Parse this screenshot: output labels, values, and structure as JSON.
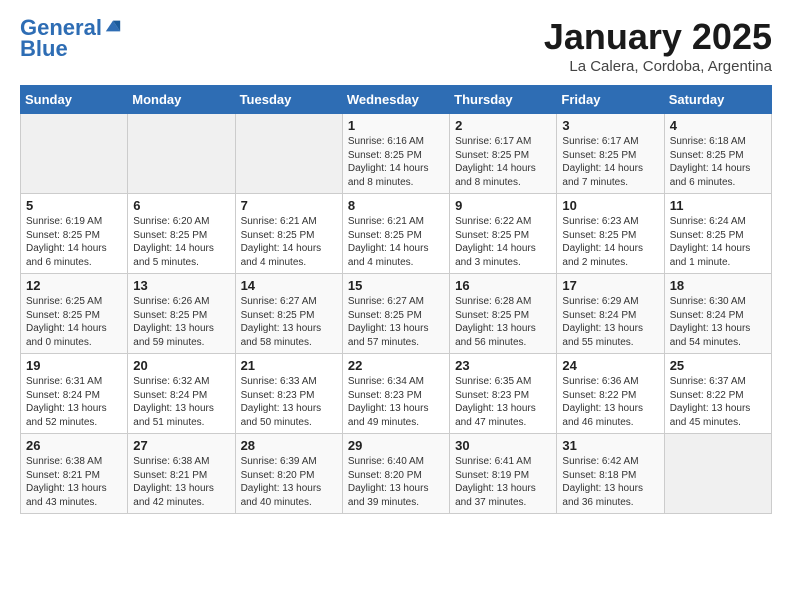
{
  "header": {
    "logo_line1": "General",
    "logo_line2": "Blue",
    "month": "January 2025",
    "location": "La Calera, Cordoba, Argentina"
  },
  "days_of_week": [
    "Sunday",
    "Monday",
    "Tuesday",
    "Wednesday",
    "Thursday",
    "Friday",
    "Saturday"
  ],
  "weeks": [
    [
      {
        "day": "",
        "content": ""
      },
      {
        "day": "",
        "content": ""
      },
      {
        "day": "",
        "content": ""
      },
      {
        "day": "1",
        "content": "Sunrise: 6:16 AM\nSunset: 8:25 PM\nDaylight: 14 hours\nand 8 minutes."
      },
      {
        "day": "2",
        "content": "Sunrise: 6:17 AM\nSunset: 8:25 PM\nDaylight: 14 hours\nand 8 minutes."
      },
      {
        "day": "3",
        "content": "Sunrise: 6:17 AM\nSunset: 8:25 PM\nDaylight: 14 hours\nand 7 minutes."
      },
      {
        "day": "4",
        "content": "Sunrise: 6:18 AM\nSunset: 8:25 PM\nDaylight: 14 hours\nand 6 minutes."
      }
    ],
    [
      {
        "day": "5",
        "content": "Sunrise: 6:19 AM\nSunset: 8:25 PM\nDaylight: 14 hours\nand 6 minutes."
      },
      {
        "day": "6",
        "content": "Sunrise: 6:20 AM\nSunset: 8:25 PM\nDaylight: 14 hours\nand 5 minutes."
      },
      {
        "day": "7",
        "content": "Sunrise: 6:21 AM\nSunset: 8:25 PM\nDaylight: 14 hours\nand 4 minutes."
      },
      {
        "day": "8",
        "content": "Sunrise: 6:21 AM\nSunset: 8:25 PM\nDaylight: 14 hours\nand 4 minutes."
      },
      {
        "day": "9",
        "content": "Sunrise: 6:22 AM\nSunset: 8:25 PM\nDaylight: 14 hours\nand 3 minutes."
      },
      {
        "day": "10",
        "content": "Sunrise: 6:23 AM\nSunset: 8:25 PM\nDaylight: 14 hours\nand 2 minutes."
      },
      {
        "day": "11",
        "content": "Sunrise: 6:24 AM\nSunset: 8:25 PM\nDaylight: 14 hours\nand 1 minute."
      }
    ],
    [
      {
        "day": "12",
        "content": "Sunrise: 6:25 AM\nSunset: 8:25 PM\nDaylight: 14 hours\nand 0 minutes."
      },
      {
        "day": "13",
        "content": "Sunrise: 6:26 AM\nSunset: 8:25 PM\nDaylight: 13 hours\nand 59 minutes."
      },
      {
        "day": "14",
        "content": "Sunrise: 6:27 AM\nSunset: 8:25 PM\nDaylight: 13 hours\nand 58 minutes."
      },
      {
        "day": "15",
        "content": "Sunrise: 6:27 AM\nSunset: 8:25 PM\nDaylight: 13 hours\nand 57 minutes."
      },
      {
        "day": "16",
        "content": "Sunrise: 6:28 AM\nSunset: 8:25 PM\nDaylight: 13 hours\nand 56 minutes."
      },
      {
        "day": "17",
        "content": "Sunrise: 6:29 AM\nSunset: 8:24 PM\nDaylight: 13 hours\nand 55 minutes."
      },
      {
        "day": "18",
        "content": "Sunrise: 6:30 AM\nSunset: 8:24 PM\nDaylight: 13 hours\nand 54 minutes."
      }
    ],
    [
      {
        "day": "19",
        "content": "Sunrise: 6:31 AM\nSunset: 8:24 PM\nDaylight: 13 hours\nand 52 minutes."
      },
      {
        "day": "20",
        "content": "Sunrise: 6:32 AM\nSunset: 8:24 PM\nDaylight: 13 hours\nand 51 minutes."
      },
      {
        "day": "21",
        "content": "Sunrise: 6:33 AM\nSunset: 8:23 PM\nDaylight: 13 hours\nand 50 minutes."
      },
      {
        "day": "22",
        "content": "Sunrise: 6:34 AM\nSunset: 8:23 PM\nDaylight: 13 hours\nand 49 minutes."
      },
      {
        "day": "23",
        "content": "Sunrise: 6:35 AM\nSunset: 8:23 PM\nDaylight: 13 hours\nand 47 minutes."
      },
      {
        "day": "24",
        "content": "Sunrise: 6:36 AM\nSunset: 8:22 PM\nDaylight: 13 hours\nand 46 minutes."
      },
      {
        "day": "25",
        "content": "Sunrise: 6:37 AM\nSunset: 8:22 PM\nDaylight: 13 hours\nand 45 minutes."
      }
    ],
    [
      {
        "day": "26",
        "content": "Sunrise: 6:38 AM\nSunset: 8:21 PM\nDaylight: 13 hours\nand 43 minutes."
      },
      {
        "day": "27",
        "content": "Sunrise: 6:38 AM\nSunset: 8:21 PM\nDaylight: 13 hours\nand 42 minutes."
      },
      {
        "day": "28",
        "content": "Sunrise: 6:39 AM\nSunset: 8:20 PM\nDaylight: 13 hours\nand 40 minutes."
      },
      {
        "day": "29",
        "content": "Sunrise: 6:40 AM\nSunset: 8:20 PM\nDaylight: 13 hours\nand 39 minutes."
      },
      {
        "day": "30",
        "content": "Sunrise: 6:41 AM\nSunset: 8:19 PM\nDaylight: 13 hours\nand 37 minutes."
      },
      {
        "day": "31",
        "content": "Sunrise: 6:42 AM\nSunset: 8:18 PM\nDaylight: 13 hours\nand 36 minutes."
      },
      {
        "day": "",
        "content": ""
      }
    ]
  ]
}
